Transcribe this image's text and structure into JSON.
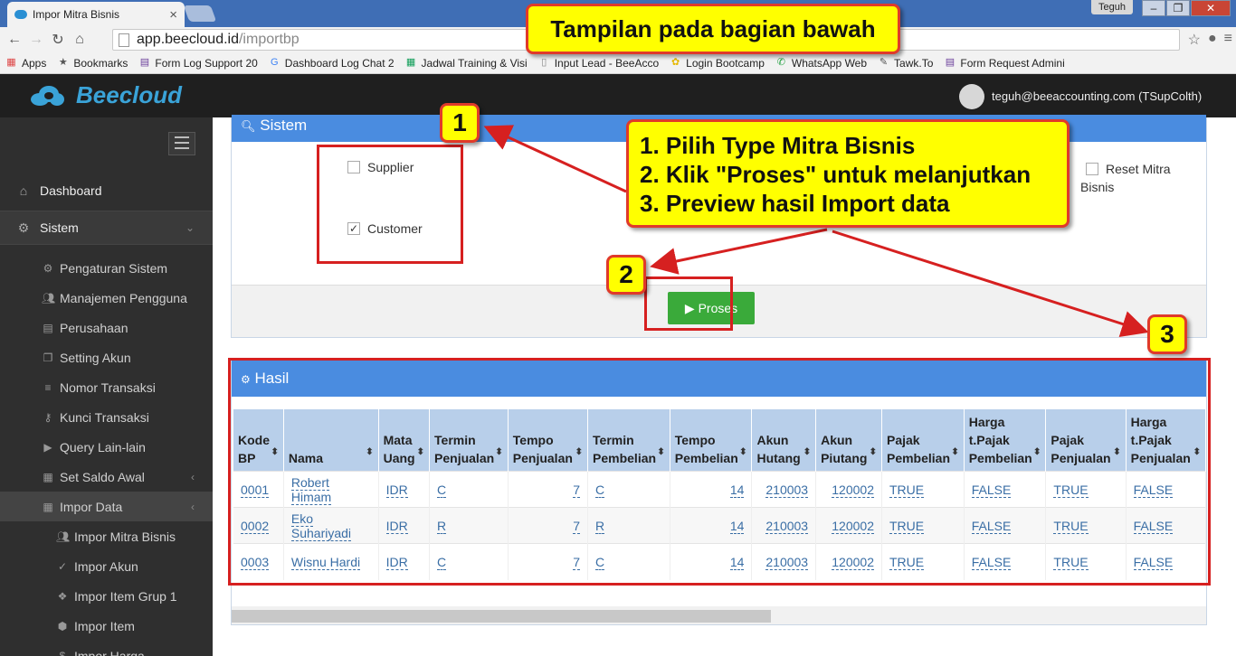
{
  "browser": {
    "tab_title": "Impor Mitra Bisnis",
    "tab_close": "×",
    "win_user": "Teguh",
    "url_host": "app.beecloud.id",
    "url_path": "/importbp",
    "bookmarks": [
      {
        "label": "Apps",
        "icon": "apps-grid-icon",
        "color": "#d44"
      },
      {
        "label": "Bookmarks",
        "icon": "star-icon",
        "color": "#555"
      },
      {
        "label": "Form Log Support 20",
        "icon": "form-icon",
        "color": "#6a3d9a"
      },
      {
        "label": "Dashboard Log Chat 2",
        "icon": "google-icon",
        "color": "#4285f4"
      },
      {
        "label": "Jadwal Training & Visi",
        "icon": "sheet-icon",
        "color": "#0f9d58"
      },
      {
        "label": "Input Lead - BeeAcco",
        "icon": "page-icon",
        "color": "#888"
      },
      {
        "label": "Login Bootcamp",
        "icon": "bee-icon",
        "color": "#e6b800"
      },
      {
        "label": "WhatsApp Web",
        "icon": "whatsapp-icon",
        "color": "#25a244"
      },
      {
        "label": "Tawk.To",
        "icon": "tawk-icon",
        "color": "#555"
      },
      {
        "label": "Form Request Admini",
        "icon": "form-icon",
        "color": "#6a3d9a"
      }
    ]
  },
  "header": {
    "brand": "Beecloud",
    "user": "teguh@beeaccounting.com (TSupColth)"
  },
  "sidebar": {
    "items": [
      {
        "label": "Dashboard",
        "icon": "home-icon"
      },
      {
        "label": "Sistem",
        "icon": "gears-icon"
      }
    ],
    "sistem_sub": [
      {
        "label": "Pengaturan Sistem",
        "icon": "gear-icon"
      },
      {
        "label": "Manajemen Pengguna",
        "icon": "users-icon"
      },
      {
        "label": "Perusahaan",
        "icon": "building-icon"
      },
      {
        "label": "Setting Akun",
        "icon": "copy-icon"
      },
      {
        "label": "Nomor Transaksi",
        "icon": "list-icon"
      },
      {
        "label": "Kunci Transaksi",
        "icon": "key-icon"
      },
      {
        "label": "Query Lain-lain",
        "icon": "play-icon"
      },
      {
        "label": "Set Saldo Awal",
        "icon": "table-icon"
      },
      {
        "label": "Impor Data",
        "icon": "table-icon"
      }
    ],
    "impor_sub": [
      {
        "label": "Impor Mitra Bisnis",
        "icon": "users-icon"
      },
      {
        "label": "Impor Akun",
        "icon": "check-icon"
      },
      {
        "label": "Impor Item Grup 1",
        "icon": "dropbox-icon"
      },
      {
        "label": "Impor Item",
        "icon": "cubes-icon"
      },
      {
        "label": "Impor Harga",
        "icon": "dollar-icon"
      }
    ]
  },
  "sistem_panel": {
    "title": "Sistem",
    "supplier": "Supplier",
    "customer": "Customer",
    "reset_line1": "Reset Mitra",
    "reset_line2": "Bisnis",
    "proses": "Proses"
  },
  "hasil_panel": {
    "title": "Hasil",
    "columns": [
      [
        "Kode",
        "BP"
      ],
      [
        "Nama"
      ],
      [
        "Mata",
        "Uang"
      ],
      [
        "Termin",
        "Penjualan"
      ],
      [
        "Tempo",
        "Penjualan"
      ],
      [
        "Termin",
        "Pembelian"
      ],
      [
        "Tempo",
        "Pembelian"
      ],
      [
        "Akun",
        "Hutang"
      ],
      [
        "Akun",
        "Piutang"
      ],
      [
        "Pajak",
        "Pembelian"
      ],
      [
        "Harga",
        "t.Pajak",
        "Pembelian"
      ],
      [
        "Pajak",
        "Penjualan"
      ],
      [
        "Harga",
        "t.Pajak",
        "Penjualan"
      ]
    ],
    "rows": [
      [
        "0001",
        "Robert Himam",
        "IDR",
        "C",
        "7",
        "C",
        "14",
        "210003",
        "120002",
        "TRUE",
        "FALSE",
        "TRUE",
        "FALSE"
      ],
      [
        "0002",
        "Eko Suhariyadi",
        "IDR",
        "R",
        "7",
        "R",
        "14",
        "210003",
        "120002",
        "TRUE",
        "FALSE",
        "TRUE",
        "FALSE"
      ],
      [
        "0003",
        "Wisnu Hardi",
        "IDR",
        "C",
        "7",
        "C",
        "14",
        "210003",
        "120002",
        "TRUE",
        "FALSE",
        "TRUE",
        "FALSE"
      ]
    ]
  },
  "annotations": {
    "top_note": "Tampilan pada bagian bawah",
    "step1": "1. Pilih Type Mitra Bisnis",
    "step2": "2. Klik \"Proses\" untuk melanjutkan",
    "step3": "3. Preview hasil Import data",
    "badge1": "1",
    "badge2": "2",
    "badge3": "3",
    "accent": "#e03a2a"
  }
}
